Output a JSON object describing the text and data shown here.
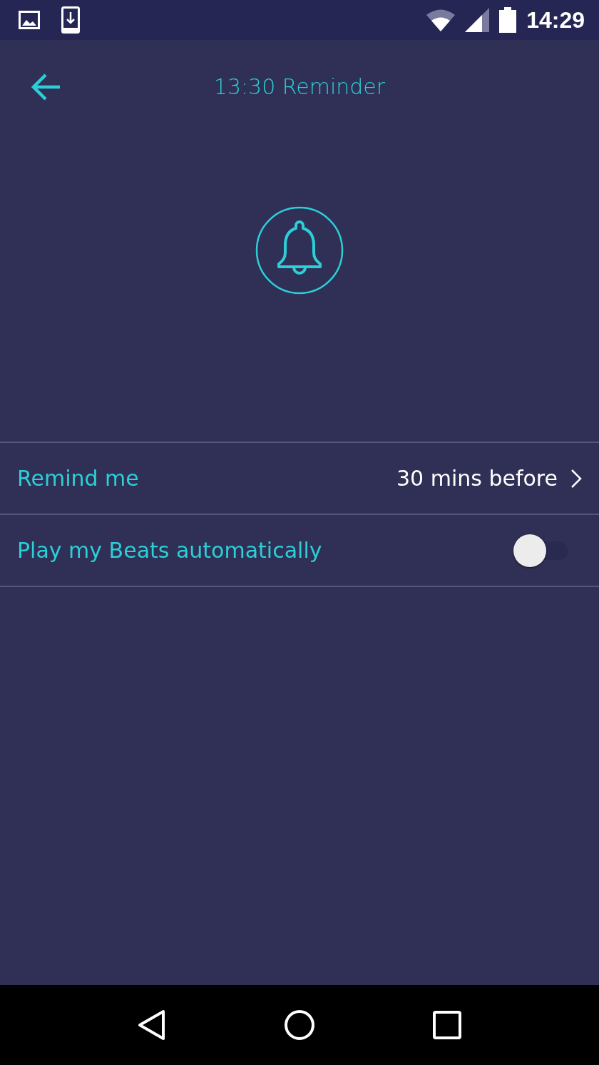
{
  "status_bar": {
    "time": "14:29"
  },
  "header": {
    "title": "13:30 Reminder"
  },
  "settings": [
    {
      "kind": "link",
      "label": "Remind me",
      "value": "30 mins before"
    },
    {
      "kind": "toggle",
      "label": "Play my Beats automatically",
      "on": false
    }
  ]
}
